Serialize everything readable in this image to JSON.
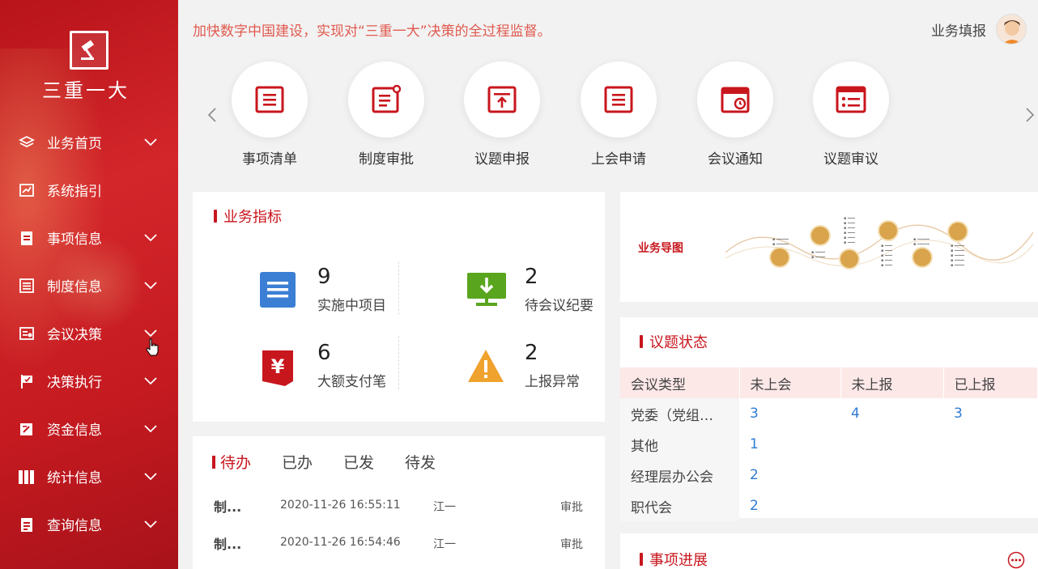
{
  "app": {
    "logo_text": "三重一大",
    "slogan": "加快数字中国建设，实现对“三重一大”决策的全过程监督。",
    "user_label": "业务填报"
  },
  "sidebar": {
    "items": [
      {
        "label": "业务首页",
        "icon": "layers-icon",
        "has_chevron": true
      },
      {
        "label": "系统指引",
        "icon": "chart-icon",
        "has_chevron": false
      },
      {
        "label": "事项信息",
        "icon": "clipboard-icon",
        "has_chevron": true
      },
      {
        "label": "制度信息",
        "icon": "list-doc-icon",
        "has_chevron": true
      },
      {
        "label": "会议决策",
        "icon": "meeting-doc-icon",
        "has_chevron": true
      },
      {
        "label": "决策执行",
        "icon": "flag-icon",
        "has_chevron": true
      },
      {
        "label": "资金信息",
        "icon": "edit-doc-icon",
        "has_chevron": true
      },
      {
        "label": "统计信息",
        "icon": "books-icon",
        "has_chevron": true
      },
      {
        "label": "查询信息",
        "icon": "search-doc-icon",
        "has_chevron": true
      }
    ]
  },
  "quick_nav": {
    "items": [
      {
        "label": "事项清单",
        "icon": "list-icon"
      },
      {
        "label": "制度审批",
        "icon": "doc-approve-icon"
      },
      {
        "label": "议题申报",
        "icon": "upload-doc-icon"
      },
      {
        "label": "上会申请",
        "icon": "list-icon"
      },
      {
        "label": "会议通知",
        "icon": "calendar-icon"
      },
      {
        "label": "议题审议",
        "icon": "review-icon"
      }
    ]
  },
  "metrics": {
    "title": "业务指标",
    "items": [
      {
        "value": "9",
        "label": "实施中项目",
        "icon": "list-blue-icon",
        "color": "#3b7fd4"
      },
      {
        "value": "2",
        "label": "待会议纪要",
        "icon": "monitor-download-icon",
        "color": "#5aa51e"
      },
      {
        "value": "6",
        "label": "大额支付笔",
        "icon": "yuan-icon",
        "color": "#c8161d"
      },
      {
        "value": "2",
        "label": "上报异常",
        "icon": "warning-icon",
        "color": "#f0a22e"
      }
    ]
  },
  "todo": {
    "tabs": [
      "待办",
      "已办",
      "已发",
      "待发"
    ],
    "rows": [
      {
        "name": "制...",
        "time": "2020-11-26 16:55:11",
        "user": "江一",
        "type": "审批"
      },
      {
        "name": "制...",
        "time": "2020-11-26 16:54:46",
        "user": "江一",
        "type": "审批"
      }
    ]
  },
  "mindmap": {
    "title": "业务导图"
  },
  "topic_status": {
    "title": "议题状态",
    "headers": [
      "会议类型",
      "未上会",
      "未上报",
      "已上报"
    ],
    "rows": [
      [
        "党委（党组…",
        "3",
        "4",
        "3"
      ],
      [
        "其他",
        "1",
        "",
        ""
      ],
      [
        "经理层办公会",
        "2",
        "",
        ""
      ],
      [
        "职代会",
        "2",
        "",
        ""
      ]
    ]
  },
  "progress": {
    "title": "事项进展"
  },
  "colors": {
    "brand_red": "#c8161d",
    "link_blue": "#2f7bd3"
  }
}
